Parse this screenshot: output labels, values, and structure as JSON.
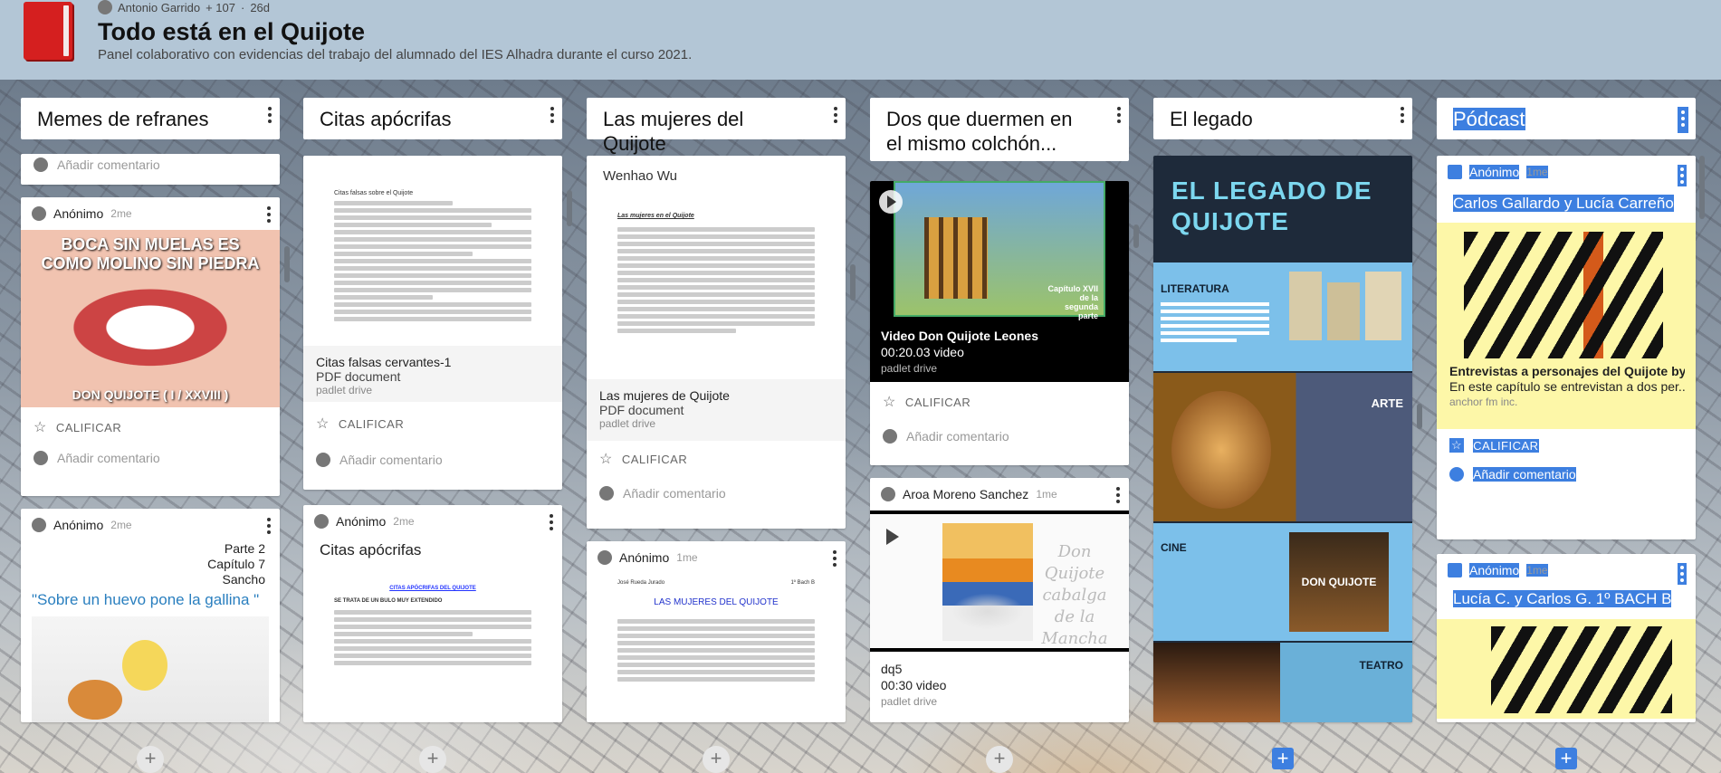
{
  "header": {
    "author": "Antonio Garrido",
    "likes": "+ 107",
    "age": "26d",
    "title": "Todo está en el Quijote",
    "subtitle": "Panel colaborativo con evidencias del trabajo del alumnado del IES Alhadra durante el curso 2021."
  },
  "columns": [
    {
      "title": "Memes de refranes"
    },
    {
      "title": "Citas apócrifas"
    },
    {
      "title": "Las mujeres del Quijote"
    },
    {
      "title": "Dos que duermen en el mismo colchón..."
    },
    {
      "title": "El legado"
    },
    {
      "title": "Pódcast"
    }
  ],
  "common": {
    "rate": "CALIFICAR",
    "add_comment": "Añadir comentario"
  },
  "col1": {
    "card1": {
      "user": "Anónimo",
      "time": "2me",
      "meme_top": "BOCA SIN MUELAS ES COMO MOLINO SIN PIEDRA",
      "meme_bottom": "DON QUIJOTE ( I / XXVIII )"
    },
    "card2": {
      "user": "Anónimo",
      "time": "2me",
      "part": "Parte 2",
      "chapter": "Capítulo 7",
      "who": "Sancho",
      "quote": "\"Sobre un huevo pone la gallina \""
    }
  },
  "col2": {
    "card1": {
      "doc_title": "Citas falsas sobre el Quijote",
      "file": "Citas falsas cervantes-1",
      "type": "PDF document",
      "source": "padlet drive"
    },
    "card2": {
      "user": "Anónimo",
      "time": "2me",
      "heading": "Citas apócrifas",
      "doc_title": "CITAS APÓCRIFAS DEL QUIJOTE",
      "doc_sub": "SE TRATA DE UN BULO MUY EXTENDIDO"
    }
  },
  "col3": {
    "card1": {
      "author": "Wenhao Wu",
      "doc_title": "Las mujeres en el Quijote",
      "file": "Las mujeres de Quijote",
      "type": "PDF document",
      "source": "padlet drive"
    },
    "card2": {
      "user": "Anónimo",
      "time": "1me",
      "doc_author": "José Rueda Jurado",
      "doc_class": "1º Bach B",
      "doc_title": "LAS MUJERES DEL QUIJOTE"
    }
  },
  "col4": {
    "card1": {
      "caption": "Capítulo XVII de la segunda parte",
      "title": "Video Don Quijote Leones",
      "duration": "00:20.03 video",
      "source": "padlet drive"
    },
    "card2": {
      "user": "Aroa Moreno Sanchez",
      "time": "1me",
      "title": "dq5",
      "duration": "00:30 video",
      "source": "padlet drive",
      "overlay": "Don Quijote cabalga de la Mancha"
    }
  },
  "col5": {
    "banner": "EL LEGADO DE QUIJOTE",
    "lit": "LITERATURA",
    "arte": "ARTE",
    "cine": "CINE",
    "teatro": "TEATRO",
    "poster": "DON QUIJOTE"
  },
  "col6": {
    "card1": {
      "user": "Anónimo",
      "time": "1me",
      "heading": "Carlos Gallardo y Lucía Carreño",
      "title": "Entrevistas a personajes del Quijote by E...",
      "desc": "En este capítulo se entrevistan a dos per...",
      "source": "anchor fm inc."
    },
    "card2": {
      "user": "Anónimo",
      "time": "1me",
      "heading": "Lucía C. y Carlos G. 1º BACH B"
    }
  },
  "colors": {
    "accent": "#3d7fe0",
    "book": "#d51f1f",
    "highlight": "#ffef3a",
    "legacy_blue": "#7cc0ea",
    "legacy_dark": "#1e2a3a"
  }
}
